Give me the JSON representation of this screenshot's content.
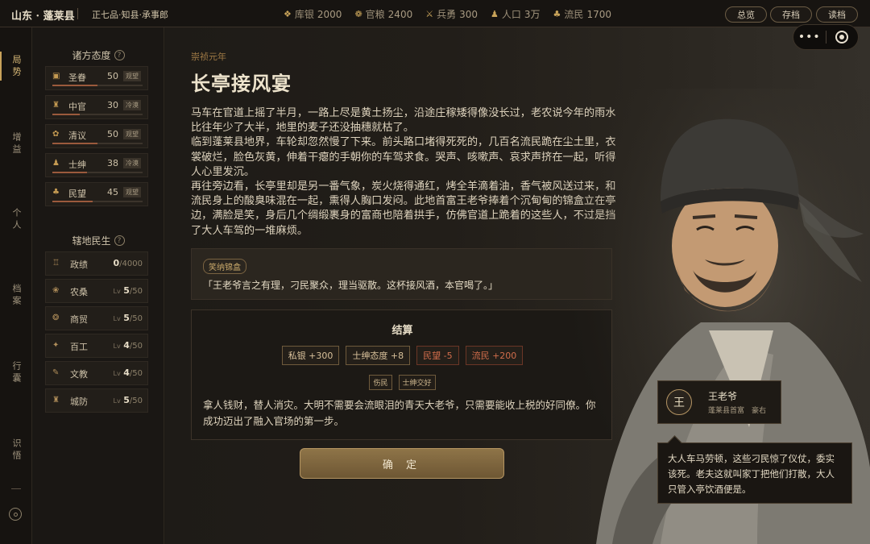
{
  "header": {
    "region": "山东 · 蓬莱县",
    "rank": "正七品·知县·承事郎",
    "resources": [
      {
        "icon": "silver-icon",
        "label": "库银",
        "value": "2000"
      },
      {
        "icon": "grain-icon",
        "label": "官粮",
        "value": "2400"
      },
      {
        "icon": "soldier-icon",
        "label": "兵勇",
        "value": "300"
      },
      {
        "icon": "population-icon",
        "label": "人口",
        "value": "3万"
      },
      {
        "icon": "refugee-icon",
        "label": "流民",
        "value": "1700"
      }
    ],
    "buttons": {
      "overview": "总览",
      "save": "存档",
      "load": "读档"
    },
    "capsule": {
      "menu": "•••"
    }
  },
  "nav": {
    "items": [
      "局势",
      "增益",
      "个人",
      "档案",
      "行囊",
      "识悟"
    ],
    "dash": "—"
  },
  "attitudes": {
    "title": "诸方态度",
    "help": "?",
    "items": [
      {
        "icon": "imperial-icon",
        "name": "圣眷",
        "value": "50",
        "tag": "观望",
        "level": 0.5
      },
      {
        "icon": "eunuch-icon",
        "name": "中官",
        "value": "30",
        "tag": "冷漠",
        "level": 0.3
      },
      {
        "icon": "scholar-icon",
        "name": "清议",
        "value": "50",
        "tag": "观望",
        "level": 0.5
      },
      {
        "icon": "gentry-icon",
        "name": "士绅",
        "value": "38",
        "tag": "冷漠",
        "level": 0.38
      },
      {
        "icon": "people-icon",
        "name": "民望",
        "value": "45",
        "tag": "观望",
        "level": 0.45
      }
    ]
  },
  "development": {
    "title": "辖地民生",
    "help": "?",
    "items": [
      {
        "icon": "merit-icon",
        "name": "政绩",
        "lv": "",
        "value": "0",
        "max": "/4000"
      },
      {
        "icon": "farm-icon",
        "name": "农桑",
        "lv": "Lv",
        "value": "5",
        "max": "/50"
      },
      {
        "icon": "trade-icon",
        "name": "商贸",
        "lv": "Lv",
        "value": "5",
        "max": "/50"
      },
      {
        "icon": "craft-icon",
        "name": "百工",
        "lv": "Lv",
        "value": "4",
        "max": "/50"
      },
      {
        "icon": "education-icon",
        "name": "文教",
        "lv": "Lv",
        "value": "4",
        "max": "/50"
      },
      {
        "icon": "defense-icon",
        "name": "城防",
        "lv": "Lv",
        "value": "5",
        "max": "/50"
      }
    ]
  },
  "event": {
    "era": "崇祯元年",
    "title": "长亭接风宴",
    "paragraphs": [
      "马车在官道上摇了半月，一路上尽是黄土扬尘，沿途庄稼矮得像没长过，老农说今年的雨水比往年少了大半，地里的麦子还没抽穗就枯了。",
      "临到蓬莱县地界，车轮却忽然慢了下来。前头路口堵得死死的，几百名流民跪在尘土里，衣裳破烂，脸色灰黄，伸着干瘪的手朝你的车驾求食。哭声、咳嗽声、哀求声挤在一起，听得人心里发沉。",
      "再往旁边看，长亭里却是另一番气象，炭火烧得通红，烤全羊滴着油，香气被风送过来，和流民身上的酸臭味混在一起，熏得人胸口发闷。此地首富王老爷捧着个沉甸甸的锦盒立在亭边，满脸是笑，身后几个绸缎裹身的富商也陪着拱手，仿佛官道上跪着的这些人，不过是挡了大人车驾的一堆麻烦。"
    ],
    "choice": {
      "label": "笑纳锦盒",
      "quote": "「王老爷言之有理，刁民聚众，理当驱散。这杯接风酒，本官喝了。」"
    },
    "settlement": {
      "title": "结算",
      "effects": [
        {
          "text": "私银 +300",
          "type": "pos"
        },
        {
          "text": "士绅态度 +8",
          "type": "pos"
        },
        {
          "text": "民望 -5",
          "type": "neg"
        },
        {
          "text": "流民 +200",
          "type": "neg"
        }
      ],
      "tags": [
        "伤民",
        "士绅交好"
      ],
      "text": "拿人钱财，替人消灾。大明不需要会流眼泪的青天大老爷，只需要能收上税的好同僚。你成功迈出了融入官场的第一步。"
    },
    "confirm": "确 定"
  },
  "npc": {
    "avatar": "王",
    "name": "王老爷",
    "subtitle": "蓬莱县首富　豪右",
    "speech": "大人车马劳顿，这些刁民惊了仪仗，委实该死。老夫这就叫家丁把他们打散，大人只管入亭饮酒便是。"
  },
  "colors": {
    "accent": "#c8a25a",
    "negative": "#d16d4b",
    "background": "#1c1915"
  }
}
